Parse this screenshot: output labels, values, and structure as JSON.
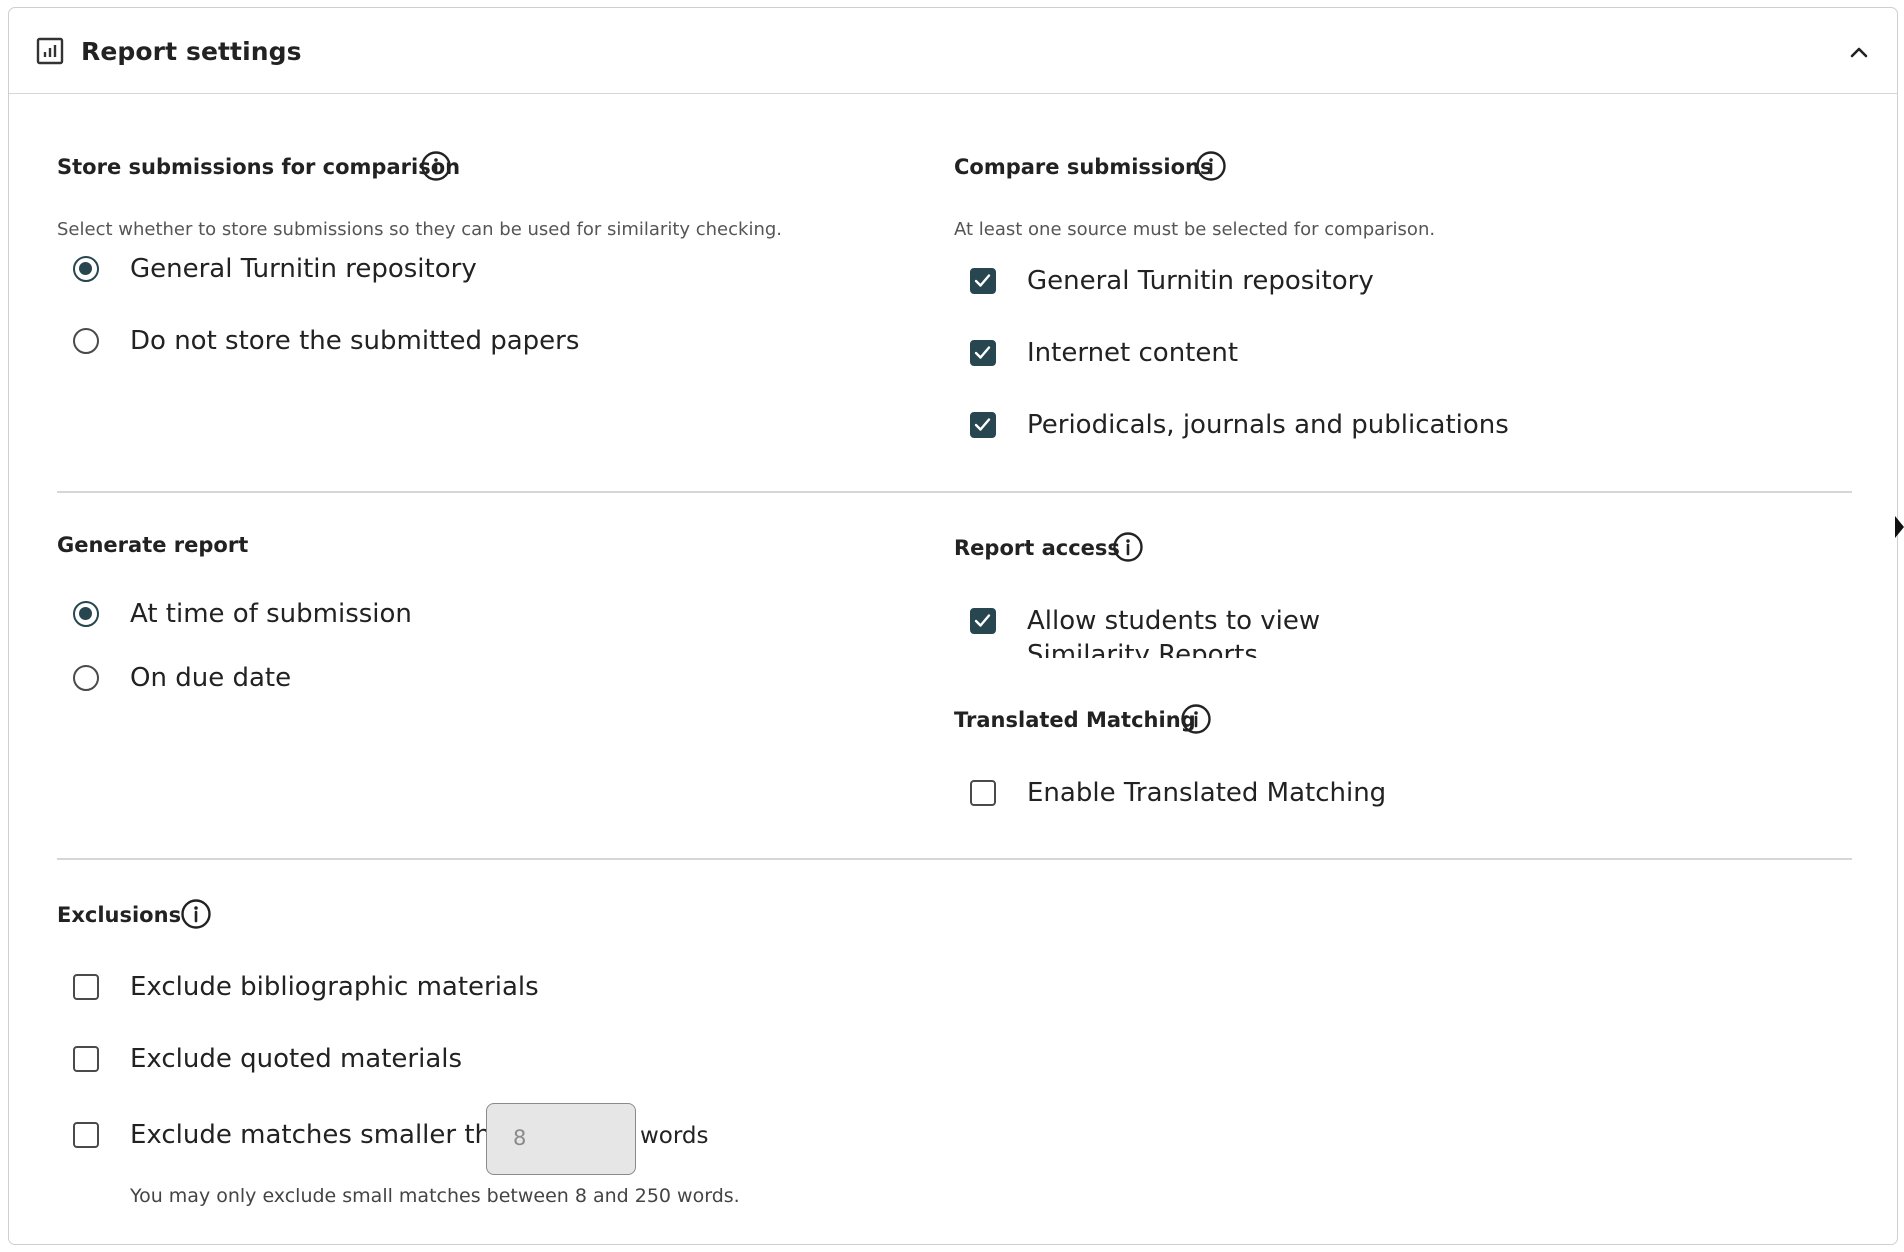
{
  "header": {
    "title": "Report settings",
    "icon": "report-chart-icon",
    "collapse_icon": "chevron-up-icon"
  },
  "store_submissions": {
    "title": "Store submissions for comparison",
    "description": "Select whether to store submissions so they can be used for similarity checking.",
    "options": [
      {
        "label": "General Turnitin repository",
        "selected": true
      },
      {
        "label": "Do not store the submitted papers",
        "selected": false
      }
    ]
  },
  "compare_submissions": {
    "title": "Compare submissions",
    "description": "At least one source must be selected for comparison.",
    "options": [
      {
        "label": "General Turnitin repository",
        "checked": true
      },
      {
        "label": "Internet content",
        "checked": true
      },
      {
        "label": "Periodicals, journals and publications",
        "checked": true
      }
    ]
  },
  "generate_report": {
    "title": "Generate report",
    "options": [
      {
        "label": "At time of submission",
        "selected": true
      },
      {
        "label": "On due date",
        "selected": false
      }
    ]
  },
  "report_access": {
    "title": "Report access",
    "option": {
      "label": "Allow students to view Similarity Reports",
      "checked": true
    }
  },
  "translated_matching": {
    "title": "Translated Matching",
    "option": {
      "label": "Enable Translated Matching",
      "checked": false
    }
  },
  "exclusions": {
    "title": "Exclusions",
    "options": [
      {
        "label": "Exclude bibliographic materials",
        "checked": false
      },
      {
        "label": "Exclude quoted materials",
        "checked": false
      },
      {
        "label": "Exclude matches smaller than",
        "checked": false
      }
    ],
    "min_words_placeholder": "8",
    "words_label": "words",
    "hint": "You may only exclude small matches between 8 and 250 words."
  },
  "colors": {
    "accent": "#27464f",
    "border": "#d6d6d6",
    "text": "#222222"
  }
}
